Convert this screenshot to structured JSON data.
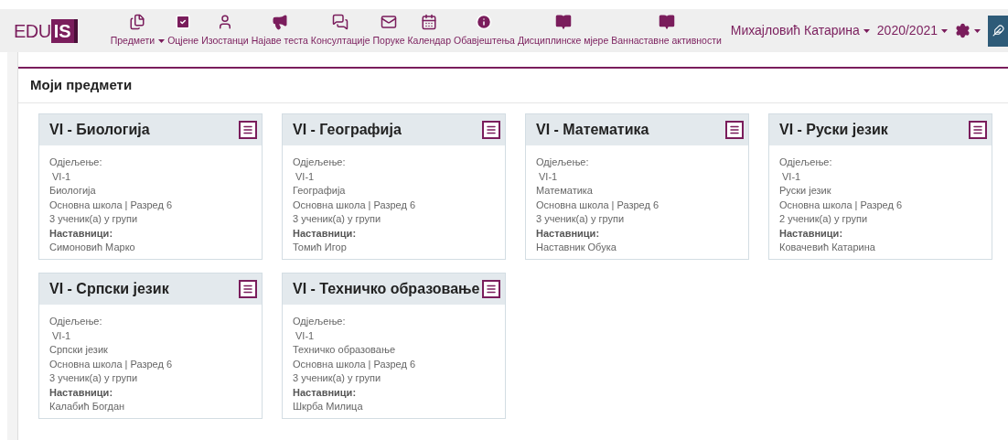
{
  "logo": {
    "text": "EDU",
    "badge": "IS"
  },
  "nav": [
    {
      "label": "Предмети",
      "dropdown": true
    },
    {
      "label": "Оцјене",
      "dropdown": false
    },
    {
      "label": "Изостанци",
      "dropdown": false
    },
    {
      "label": "Најаве теста",
      "dropdown": false
    },
    {
      "label": "Консултације",
      "dropdown": false
    },
    {
      "label": "Поруке",
      "dropdown": false
    },
    {
      "label": "Календар",
      "dropdown": false
    },
    {
      "label": "Обавјештења",
      "dropdown": false
    },
    {
      "label": "Дисциплинске мјере",
      "dropdown": false
    },
    {
      "label": "Ваннаставне активности",
      "dropdown": false
    }
  ],
  "user_menu": {
    "name": "Михајловић Катарина",
    "year": "2020/2021"
  },
  "page_title": "Моји предмети",
  "cards": [
    {
      "title": "VI - Биологија",
      "department_label": "Одјељење:",
      "department": "VI-1",
      "subject": "Биологија",
      "school": "Основна школа | Разред 6",
      "students": "3 ученик(а) у групи",
      "teachers_label": "Наставници:",
      "teachers": "Симоновић Марко"
    },
    {
      "title": "VI - Географија",
      "department_label": "Одјељење:",
      "department": "VI-1",
      "subject": "Географија",
      "school": "Основна школа | Разред 6",
      "students": "3 ученик(а) у групи",
      "teachers_label": "Наставници:",
      "teachers": "Томић Игор"
    },
    {
      "title": "VI - Математика",
      "department_label": "Одјељење:",
      "department": "VI-1",
      "subject": "Математика",
      "school": "Основна школа | Разред 6",
      "students": "3 ученик(а) у групи",
      "teachers_label": "Наставници:",
      "teachers": "Наставник Обука"
    },
    {
      "title": "VI - Руски језик",
      "department_label": "Одјељење:",
      "department": "VI-1",
      "subject": "Руски језик",
      "school": "Основна школа | Разред 6",
      "students": "2 ученик(а) у групи",
      "teachers_label": "Наставници:",
      "teachers": "Ковачевић Катарина"
    },
    {
      "title": "VI - Српски језик",
      "department_label": "Одјељење:",
      "department": "VI-1",
      "subject": "Српски језик",
      "school": "Основна школа | Разред 6",
      "students": "3 ученик(а) у групи",
      "teachers_label": "Наставници:",
      "teachers": "Калабић Богдан"
    },
    {
      "title": "VI - Техничко образовање",
      "department_label": "Одјељење:",
      "department": "VI-1",
      "subject": "Техничко образовање",
      "school": "Основна школа | Разред 6",
      "students": "3 ученик(а) у групи",
      "teachers_label": "Наставници:",
      "teachers": "Шкрба Милица"
    }
  ]
}
